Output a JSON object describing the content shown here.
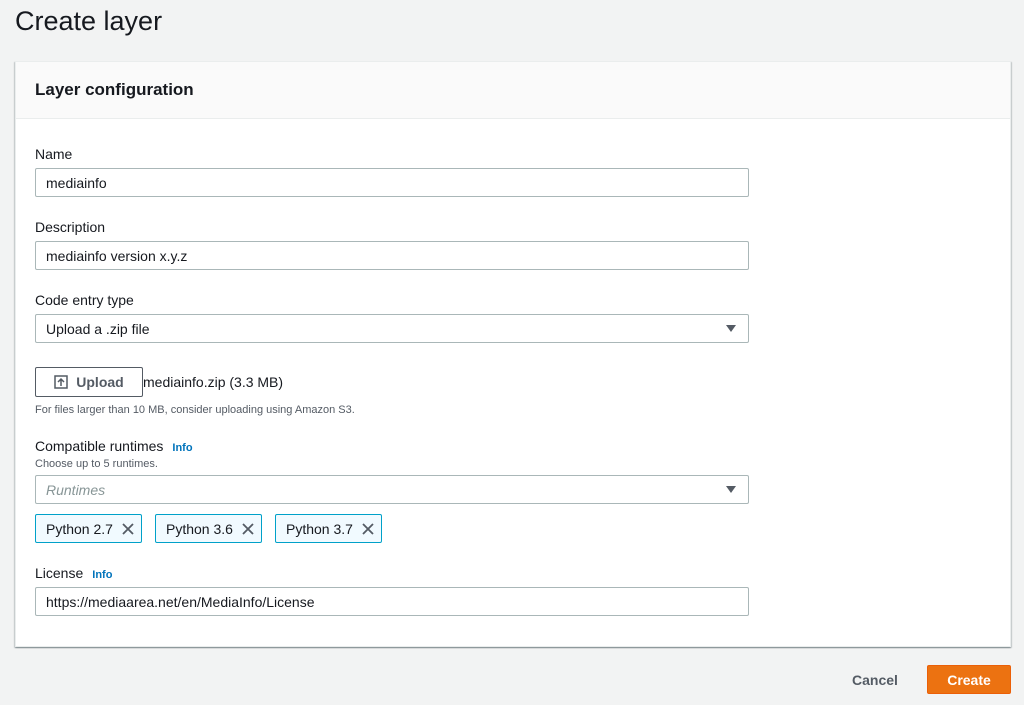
{
  "page": {
    "title": "Create layer"
  },
  "panel": {
    "title": "Layer configuration"
  },
  "name_field": {
    "label": "Name",
    "value": "mediainfo"
  },
  "description_field": {
    "label": "Description",
    "value": "mediainfo version x.y.z"
  },
  "code_entry": {
    "label": "Code entry type",
    "selected": "Upload a .zip file"
  },
  "upload": {
    "button_label": "Upload",
    "file_name": "mediainfo.zip (3.3 MB)",
    "hint": "For files larger than 10 MB, consider uploading using Amazon S3."
  },
  "runtimes": {
    "label": "Compatible runtimes",
    "info": "Info",
    "hint": "Choose up to 5 runtimes.",
    "placeholder": "Runtimes",
    "tokens": [
      "Python 2.7",
      "Python 3.6",
      "Python 3.7"
    ]
  },
  "license": {
    "label": "License",
    "info": "Info",
    "value": "https://mediaarea.net/en/MediaInfo/License"
  },
  "footer": {
    "cancel_label": "Cancel",
    "create_label": "Create"
  },
  "colors": {
    "primary_button": "#ec7211",
    "link": "#0073bb",
    "token_border": "#00a1c9"
  },
  "icons": {
    "upload": "upload-icon",
    "dropdown": "caret-down-icon",
    "remove": "close-icon"
  }
}
